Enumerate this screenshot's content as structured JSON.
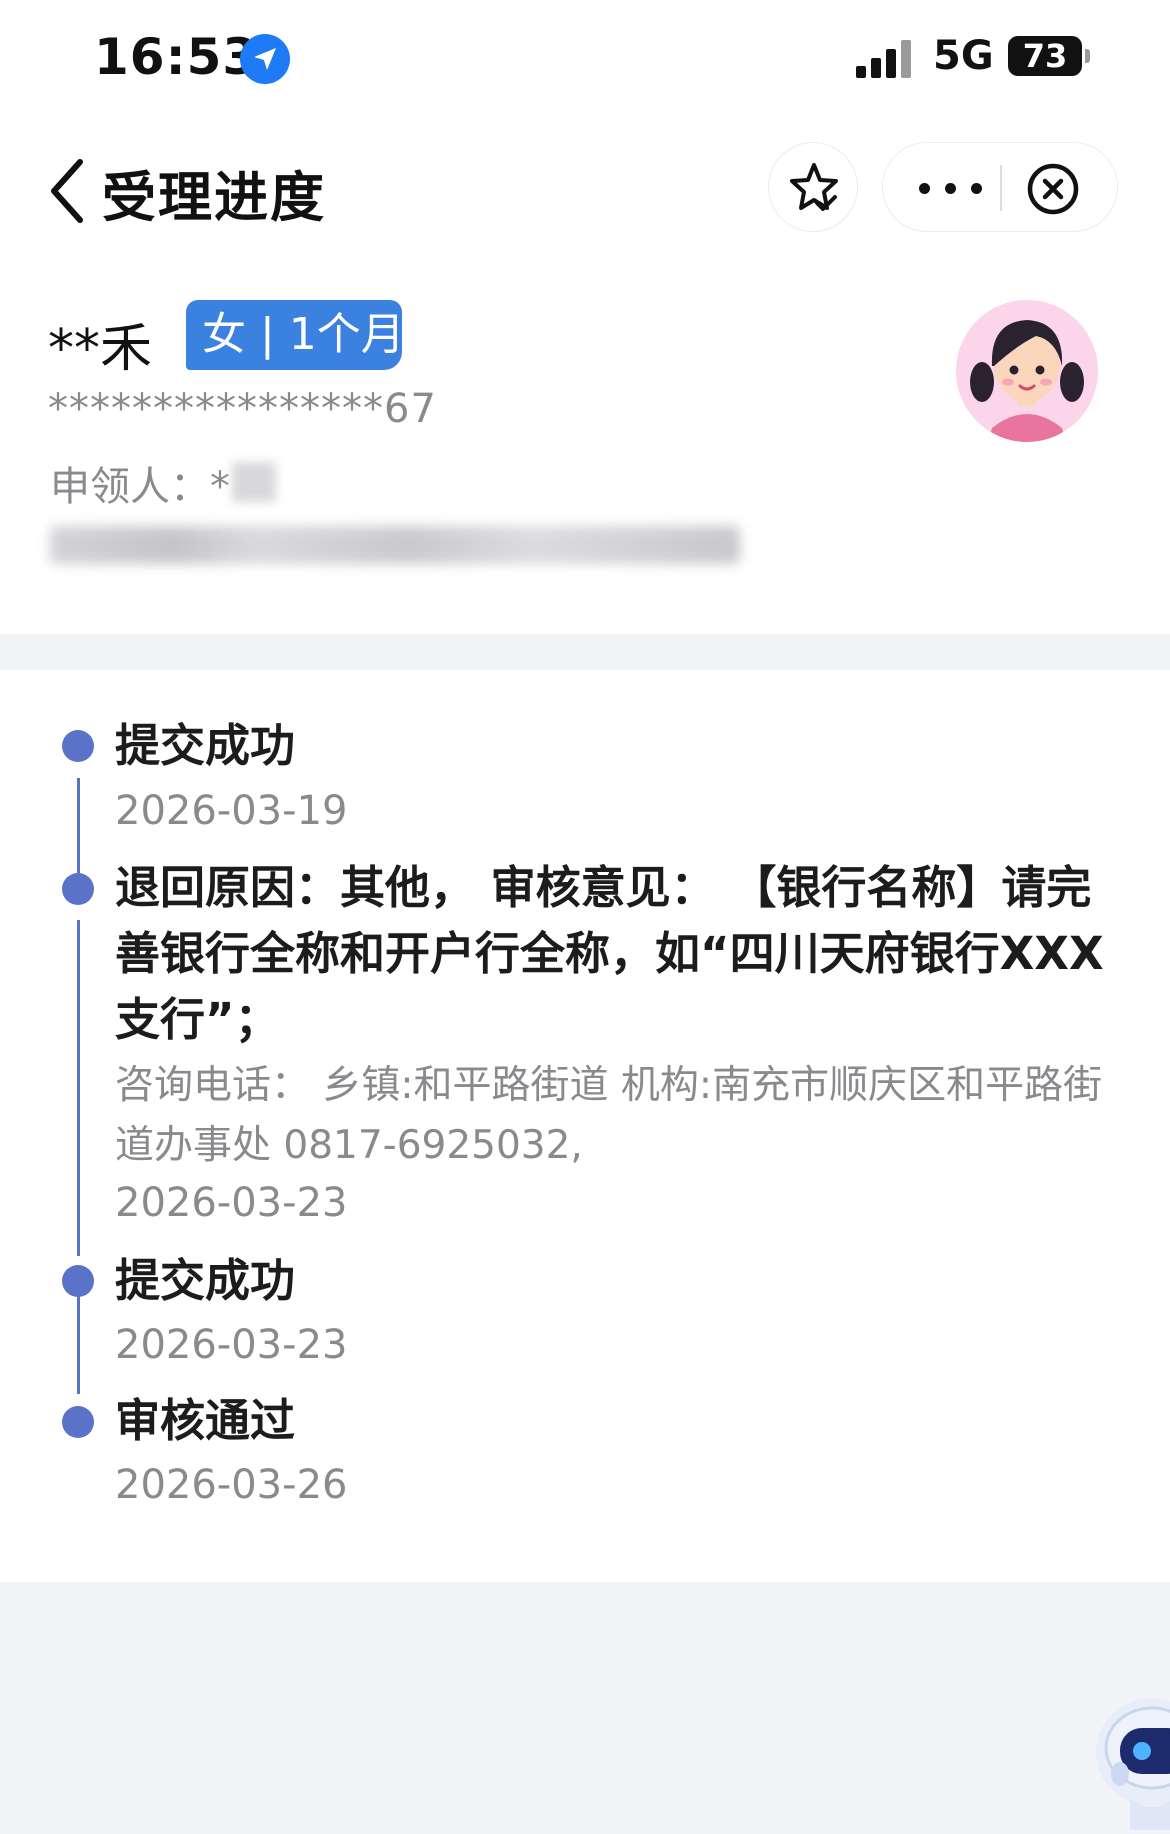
{
  "status_bar": {
    "time": "16:53",
    "network": "5G",
    "battery": "73"
  },
  "nav": {
    "title": "受理进度"
  },
  "profile": {
    "name": "**禾",
    "tag": "女 | 1个月",
    "id_number": "****************67",
    "applicant_label": "申领人：*"
  },
  "timeline": [
    {
      "title": "提交成功",
      "date": "2026-03-19"
    },
    {
      "title": "退回原因：其他， 审核意见： 【银行名称】请完善银行全称和开户行全称，如“四川天府银行XXX支行”；",
      "detail": "咨询电话： 乡镇:和平路街道 机构:南充市顺庆区和平路街道办事处 0817-6925032,",
      "date": "2026-03-23"
    },
    {
      "title": "提交成功",
      "date": "2026-03-23"
    },
    {
      "title": "审核通过",
      "date": "2026-03-26"
    }
  ],
  "colors": {
    "accent": "#5b72c9",
    "tag_bg": "#3b82e0",
    "location_icon": "#1f7bf5"
  }
}
